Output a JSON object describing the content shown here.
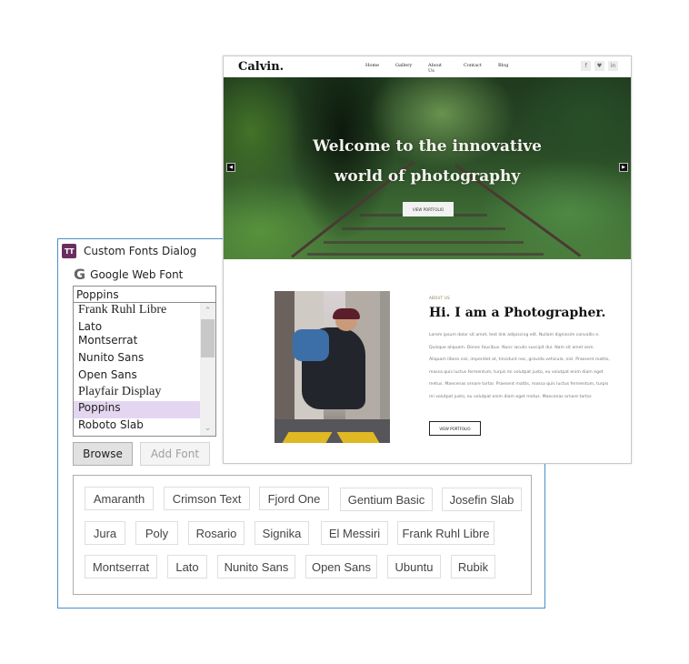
{
  "dialog": {
    "title": "Custom Fonts Dialog",
    "app_icon": "TT",
    "source_icon": "G",
    "source_label": "Google Web Font",
    "font_input_value": "Poppins",
    "font_options": [
      {
        "label": "Frank Ruhl Libre",
        "selected": false
      },
      {
        "label": "Lato",
        "selected": false
      },
      {
        "label": "Montserrat",
        "selected": false
      },
      {
        "label": "Nunito Sans",
        "selected": false
      },
      {
        "label": "Open Sans",
        "selected": false
      },
      {
        "label": "Playfair Display",
        "selected": false
      },
      {
        "label": "Poppins",
        "selected": true
      },
      {
        "label": "Roboto Slab",
        "selected": false
      }
    ],
    "scroll_up_icon": "⌃",
    "scroll_down_icon": "⌄",
    "browse_label": "Browse",
    "add_font_label": "Add Font",
    "added_fonts": [
      [
        "Amaranth",
        "Crimson Text",
        "Fjord One",
        "Gentium Basic",
        "Josefin Slab"
      ],
      [
        "Jura",
        "Poly",
        "Rosario",
        "Signika",
        "El Messiri",
        "Frank Ruhl Libre"
      ],
      [
        "Montserrat",
        "Lato",
        "Nunito Sans",
        "Open Sans",
        "Ubuntu",
        "Rubik"
      ]
    ]
  },
  "website": {
    "logo": "Calvin.",
    "nav": [
      "Home",
      "Gallery",
      "About Us",
      "Contact",
      "Blog"
    ],
    "socials": [
      "f",
      "♥",
      "in"
    ],
    "hero": {
      "title_line1": "Welcome to the innovative",
      "title_line2": "world of photography",
      "button": "VIEW PORTFOLIO",
      "prev_icon": "◀",
      "next_icon": "▶"
    },
    "about": {
      "label": "ABOUT US",
      "heading": "Hi. I am a Photographer.",
      "text": "Lorem ipsum dolor sit amet, test link adipiscing elit. Nullam dignissim convallis e. Quisque aliquam. Donec faucibus. Nunc iaculis suscipit dui. Nam sit amet sem. Aliquam libero nisl, imperdiet at, tincidunt nec, gravida vehicula, nisl. Praesent mattis, massa quis luctus fermentum, turpis mi volutpat justo, eu volutpat enim diam eget metus. Maecenas ornare tortor. Praesent mattis, massa quis luctus fermentum, turpis mi volutpat justo, eu volutpat enim diam eget metus. Maecenas ornare tortor.",
      "button": "VIEW PORTFOLIO"
    }
  }
}
